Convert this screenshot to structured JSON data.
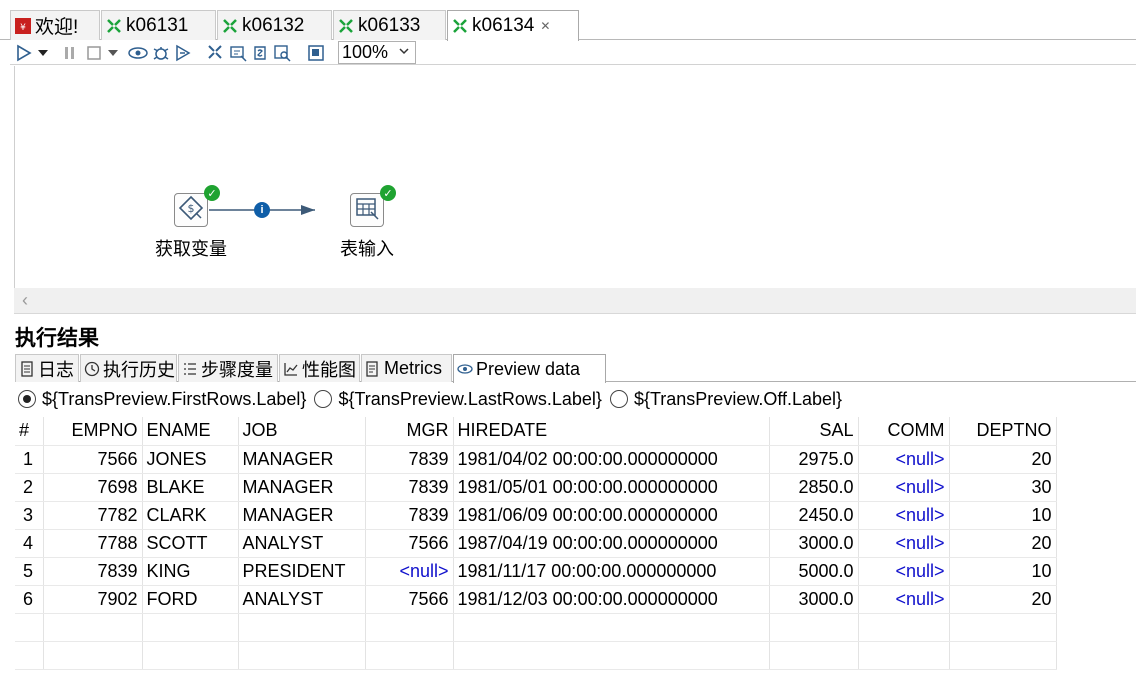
{
  "editor_tabs": [
    {
      "label": "欢迎!",
      "icon": "welcome-icon"
    },
    {
      "label": "k06131",
      "icon": "transformation-icon"
    },
    {
      "label": "k06132",
      "icon": "transformation-icon"
    },
    {
      "label": "k06133",
      "icon": "transformation-icon"
    },
    {
      "label": "k06134",
      "icon": "transformation-icon",
      "active": true
    }
  ],
  "toolbar": {
    "zoom": "100%",
    "icons": [
      "run-icon",
      "run-options-icon",
      "pause-icon",
      "stop-icon",
      "stop-options-icon",
      "preview-icon",
      "debug-icon",
      "replay-icon",
      "verify-icon",
      "impact-icon",
      "sql-icon",
      "explore-db-icon",
      "show-results-icon"
    ]
  },
  "canvas": {
    "steps": [
      {
        "label": "获取变量",
        "icon": "get-variables-icon",
        "status": "success"
      },
      {
        "label": "表输入",
        "icon": "table-input-icon",
        "status": "success"
      }
    ],
    "hop_info": "i"
  },
  "results": {
    "title": "执行结果",
    "tabs": [
      {
        "label": "日志",
        "icon": "log-icon"
      },
      {
        "label": "执行历史",
        "icon": "history-icon"
      },
      {
        "label": "步骤度量",
        "icon": "step-metrics-icon"
      },
      {
        "label": "性能图",
        "icon": "performance-icon"
      },
      {
        "label": "Metrics",
        "icon": "metrics-icon"
      },
      {
        "label": "Preview data",
        "icon": "preview-icon",
        "active": true
      }
    ],
    "radio_options": [
      {
        "label": "${TransPreview.FirstRows.Label}",
        "selected": true
      },
      {
        "label": "${TransPreview.LastRows.Label}",
        "selected": false
      },
      {
        "label": "${TransPreview.Off.Label}",
        "selected": false
      }
    ],
    "table": {
      "columns": [
        "#",
        "EMPNO",
        "ENAME",
        "JOB",
        "MGR",
        "HIREDATE",
        "SAL",
        "COMM",
        "DEPTNO"
      ],
      "rows": [
        [
          "1",
          "7566",
          "JONES",
          "MANAGER",
          "7839",
          "1981/04/02 00:00:00.000000000",
          "2975.0",
          "<null>",
          "20"
        ],
        [
          "2",
          "7698",
          "BLAKE",
          "MANAGER",
          "7839",
          "1981/05/01 00:00:00.000000000",
          "2850.0",
          "<null>",
          "30"
        ],
        [
          "3",
          "7782",
          "CLARK",
          "MANAGER",
          "7839",
          "1981/06/09 00:00:00.000000000",
          "2450.0",
          "<null>",
          "10"
        ],
        [
          "4",
          "7788",
          "SCOTT",
          "ANALYST",
          "7566",
          "1987/04/19 00:00:00.000000000",
          "3000.0",
          "<null>",
          "20"
        ],
        [
          "5",
          "7839",
          "KING",
          "PRESIDENT",
          "<null>",
          "1981/11/17 00:00:00.000000000",
          "5000.0",
          "<null>",
          "10"
        ],
        [
          "6",
          "7902",
          "FORD",
          "ANALYST",
          "7566",
          "1981/12/03 00:00:00.000000000",
          "3000.0",
          "<null>",
          "20"
        ]
      ]
    }
  },
  "colors": {
    "success_badge": "#1fa331",
    "null_text": "#1010cc",
    "hop_arrow": "#3d5a78",
    "info_dot": "#0f5ea8"
  }
}
